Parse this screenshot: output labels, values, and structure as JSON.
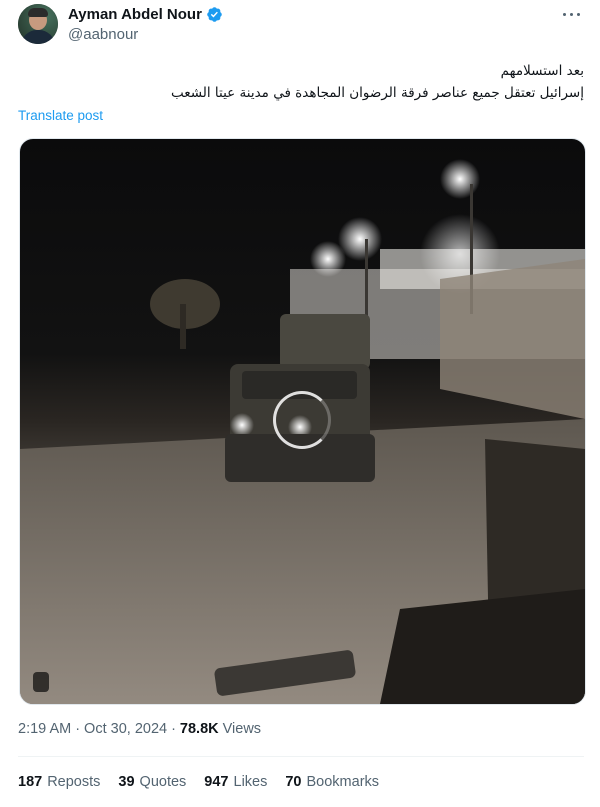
{
  "author": {
    "name": "Ayman Abdel Nour",
    "handle": "@aabnour",
    "verified": true
  },
  "post": {
    "text_line1": "بعد استسلامهم",
    "text_line2": "إسرائيل تعتقل جميع عناصر فرقة الرضوان المجاهدة في مدينة عيتا الشعب",
    "translate_label": "Translate post"
  },
  "media": {
    "type": "video",
    "state": "loading"
  },
  "meta": {
    "time": "2:19 AM",
    "separator1": "·",
    "date": "Oct 30, 2024",
    "separator2": "·",
    "views_count": "78.8K",
    "views_label": "Views"
  },
  "stats": [
    {
      "count": "187",
      "label": "Reposts"
    },
    {
      "count": "39",
      "label": "Quotes"
    },
    {
      "count": "947",
      "label": "Likes"
    },
    {
      "count": "70",
      "label": "Bookmarks"
    }
  ],
  "colors": {
    "link": "#1d9bf0",
    "verified": "#1d9bf0",
    "muted_text": "#536471"
  },
  "icons": [
    "verified-badge-icon",
    "more-options-icon",
    "video-loading-spinner-icon"
  ]
}
